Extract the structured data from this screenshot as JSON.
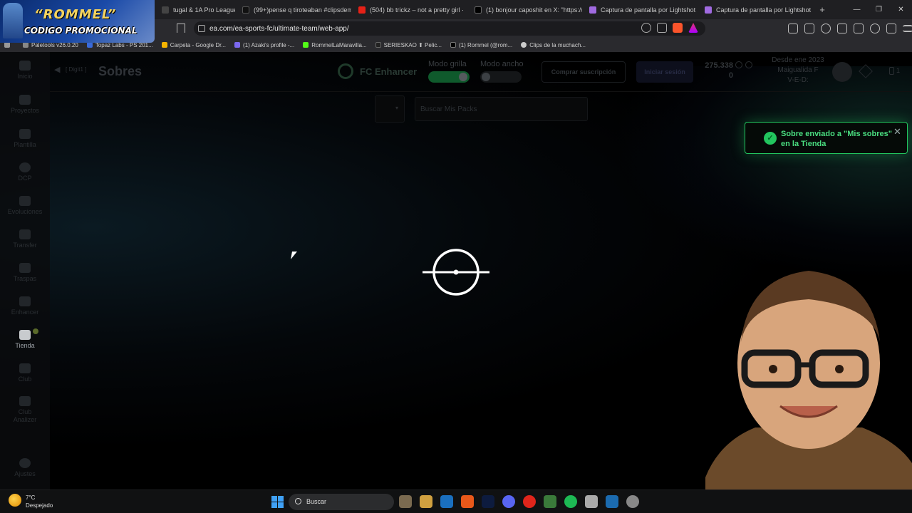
{
  "browser": {
    "tabs": [
      {
        "label": "tugal & 1A Pro League Prem",
        "color": "#444"
      },
      {
        "label": "(99+)pense q tiroteaban #clipsdemo",
        "color": "#111"
      },
      {
        "label": "(504) bb trickz – not a pretty girl ·",
        "color": "#e62117"
      },
      {
        "label": "(1) bonjour caposhit en X: \"https://t.",
        "color": "#000"
      },
      {
        "label": "Captura de pantalla por Lightshot",
        "color": "#a06ae0"
      },
      {
        "label": "Captura de pantalla por Lightshot",
        "color": "#a06ae0"
      }
    ],
    "new_tab": "+",
    "url": "ea.com/ea-sports-fc/ultimate-team/web-app/",
    "bookmarks": [
      {
        "label": "Paletools v26.0.20",
        "color": "#888"
      },
      {
        "label": "Topaz Labs - PS 201...",
        "color": "#3a6ad9"
      },
      {
        "label": "Carpeta - Google Dr...",
        "color": "#f4b400"
      },
      {
        "label": "(1) Azaki's profile -...",
        "color": "#7b68ee"
      },
      {
        "label": "RommelLaMaravilla...",
        "color": "#53fc18"
      },
      {
        "label": "SERIESKAO ⬆ Pelic...",
        "color": "#222"
      },
      {
        "label": "(1) Rommel (@rom...",
        "color": "#000"
      },
      {
        "label": "Clips de la muchach...",
        "color": "#ccc"
      }
    ]
  },
  "promo": {
    "line1": "“ROMMEL”",
    "line2": "CODIGO PROMOCIONAL"
  },
  "sidebar": {
    "items": [
      {
        "label": "Inicio"
      },
      {
        "label": "Proyectos"
      },
      {
        "label": "Plantilla"
      },
      {
        "label": "DCP"
      },
      {
        "label": "Evoluciones"
      },
      {
        "label": "Transfer"
      },
      {
        "label": "Traspas"
      },
      {
        "label": "Enhancer"
      },
      {
        "label": "Tienda"
      },
      {
        "label": "Club"
      },
      {
        "label": "Club Analizer"
      },
      {
        "label": "Ajustes"
      }
    ],
    "active": "Tienda"
  },
  "topbar": {
    "breadcrumb": "[ Digit1 ]",
    "title": "Sobres",
    "enhancer_name": "FC Enhancer",
    "mode_grid_label": "Modo grilla",
    "mode_wide_label": "Modo ancho",
    "mode_grid_on": true,
    "mode_wide_on": false,
    "buy_subscription": "Comprar suscripción",
    "login": "Iniciar sesión",
    "coins": "275.338",
    "points": "0",
    "since_line1": "Desde ene 2023",
    "since_line2": "Maigualida F",
    "since_line3": "V-E-D:",
    "count": "1"
  },
  "filters": {
    "search_placeholder": "Buscar Mis Packs"
  },
  "toast": {
    "message": "Sobre enviado a \"Mis sobres\" en la Tienda",
    "color": "#22c55e"
  },
  "taskbar": {
    "temperature": "7°C",
    "weather": "Despejado",
    "search_label": "Buscar",
    "apps": [
      "#7a6a50",
      "#d0a040",
      "#1a6fbf",
      "#e8581a",
      "#0d1b3e",
      "#5865f2",
      "#e0251b",
      "#3a7a3a",
      "#1db954",
      "#aaa",
      "#1b6bb0",
      "#888"
    ]
  }
}
